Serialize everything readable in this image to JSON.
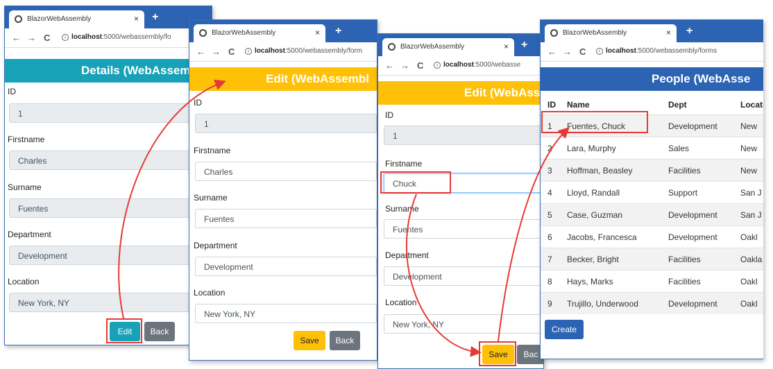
{
  "browser": {
    "tab_title": "BlazorWebAssembly",
    "new_tab": "+",
    "tab_close": "×",
    "back": "←",
    "forward": "→",
    "reload": "C",
    "minimize": "–",
    "maximize": "□",
    "close": "×",
    "url_host": "localhost",
    "url_short": ":5000/webassembly/fo",
    "url_full": ":5000/webassembly/form",
    "url_webasse": ":5000/webasse",
    "url_forms": ":5000/webassembly/forms"
  },
  "details": {
    "header": "Details (WebAssem",
    "labels": [
      "ID",
      "Firstname",
      "Surname",
      "Department",
      "Location"
    ],
    "values": [
      "1",
      "Charles",
      "Fuentes",
      "Development",
      "New York, NY"
    ],
    "edit_button": "Edit",
    "back_button": "Back"
  },
  "edit": {
    "header": "Edit (WebAssembl",
    "labels": [
      "ID",
      "Firstname",
      "Surname",
      "Department",
      "Location"
    ],
    "values": [
      "1",
      "Charles",
      "Fuentes",
      "Development",
      "New York, NY"
    ],
    "save_button": "Save",
    "back_button": "Back"
  },
  "edit2": {
    "header": "Edit (WebAss",
    "labels": [
      "ID",
      "Firstname",
      "Surname",
      "Department",
      "Location"
    ],
    "values": [
      "1",
      "Chuck",
      "Fuentes",
      "Development",
      "New York, NY"
    ],
    "save_button": "Save",
    "back_button": "Bac"
  },
  "people": {
    "header": "People (WebAsse",
    "columns": [
      "ID",
      "Name",
      "Dept",
      "Locati"
    ],
    "rows": [
      {
        "id": "1",
        "name": "Fuentes, Chuck",
        "dept": "Development",
        "loc": "New"
      },
      {
        "id": "2",
        "name": "Lara, Murphy",
        "dept": "Sales",
        "loc": "New"
      },
      {
        "id": "3",
        "name": "Hoffman, Beasley",
        "dept": "Facilities",
        "loc": "New"
      },
      {
        "id": "4",
        "name": "Lloyd, Randall",
        "dept": "Support",
        "loc": "San J"
      },
      {
        "id": "5",
        "name": "Case, Guzman",
        "dept": "Development",
        "loc": "San J"
      },
      {
        "id": "6",
        "name": "Jacobs, Francesca",
        "dept": "Development",
        "loc": "Oakl"
      },
      {
        "id": "7",
        "name": "Becker, Bright",
        "dept": "Facilities",
        "loc": "Oakla"
      },
      {
        "id": "8",
        "name": "Hays, Marks",
        "dept": "Facilities",
        "loc": "Oakl"
      },
      {
        "id": "9",
        "name": "Trujillo, Underwood",
        "dept": "Development",
        "loc": "Oakl"
      }
    ],
    "create_button": "Create"
  },
  "colors": {
    "chrome_blue": "#2c63b3",
    "info_header": "#17a2b8",
    "warning_header": "#ffc107",
    "annotation_red": "#e53935"
  }
}
